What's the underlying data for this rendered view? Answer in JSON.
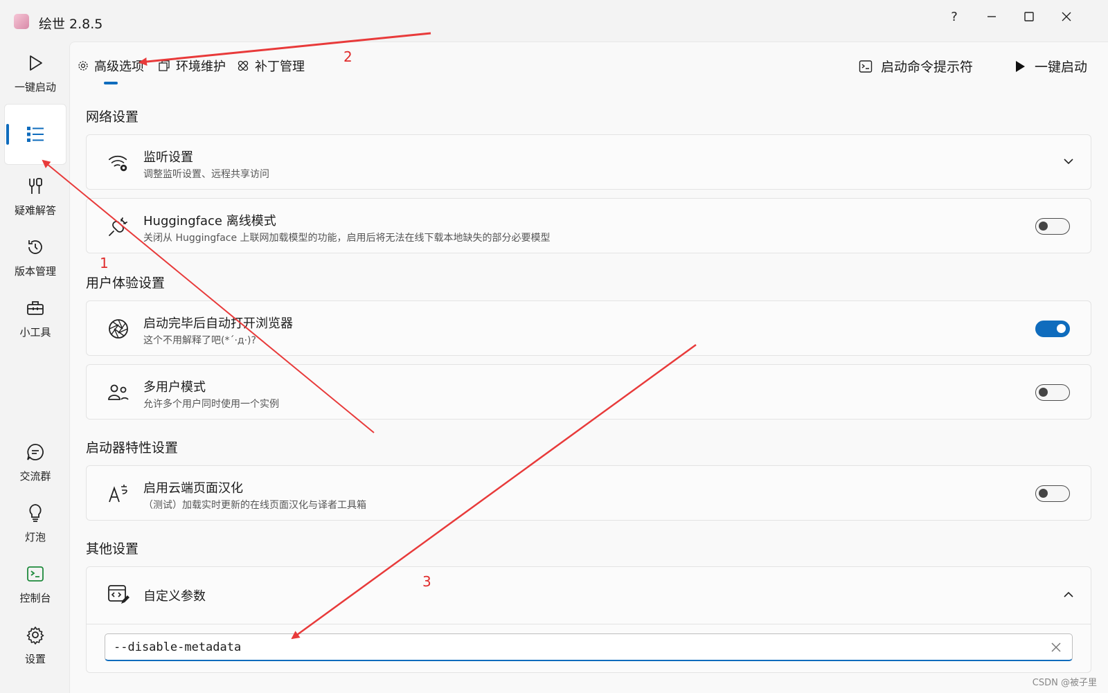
{
  "app": {
    "title": "绘世 2.8.5"
  },
  "window": {
    "help": "?",
    "minimize": "—",
    "maximize": "☐",
    "close": "✕"
  },
  "sidebar": {
    "items": [
      {
        "label": "一键启动",
        "icon": "play-icon"
      },
      {
        "label": "",
        "icon": "list-icon",
        "active": true
      },
      {
        "label": "疑难解答",
        "icon": "tools-icon"
      },
      {
        "label": "版本管理",
        "icon": "history-icon"
      },
      {
        "label": "小工具",
        "icon": "toolbox-icon"
      },
      {
        "label": "交流群",
        "icon": "chat-icon"
      },
      {
        "label": "灯泡",
        "icon": "bulb-icon"
      },
      {
        "label": "控制台",
        "icon": "console-icon"
      },
      {
        "label": "设置",
        "icon": "gear-icon"
      }
    ]
  },
  "tabs": [
    {
      "label": "高级选项",
      "icon": "gear-icon",
      "selected": true
    },
    {
      "label": "环境维护",
      "icon": "box-icon"
    },
    {
      "label": "补丁管理",
      "icon": "bandage-icon"
    }
  ],
  "header": {
    "cmd_label": "启动命令提示符",
    "launch_label": "一键启动"
  },
  "sections": {
    "network": "网络设置",
    "ux": "用户体验设置",
    "launcher": "启动器特性设置",
    "other": "其他设置"
  },
  "cards": {
    "listen": {
      "title": "监听设置",
      "desc": "调整监听设置、远程共享访问"
    },
    "hf": {
      "title": "Huggingface 离线模式",
      "desc": "关闭从 Huggingface 上联网加载模型的功能，启用后将无法在线下载本地缺失的部分必要模型",
      "on": false
    },
    "browser": {
      "title": "启动完毕后自动打开浏览器",
      "desc": "这个不用解释了吧(*´·д·)?",
      "on": true
    },
    "multi": {
      "title": "多用户模式",
      "desc": "允许多个用户同时使用一个实例",
      "on": false
    },
    "cloud": {
      "title": "启用云端页面汉化",
      "desc": "（测试）加载实时更新的在线页面汉化与译者工具箱",
      "on": false
    },
    "custom": {
      "title": "自定义参数",
      "value": "--disable-metadata"
    }
  },
  "annotations": {
    "n1": "1",
    "n2": "2",
    "n3": "3",
    "color": "#e02b2b"
  },
  "watermark": "CSDN @被子里"
}
